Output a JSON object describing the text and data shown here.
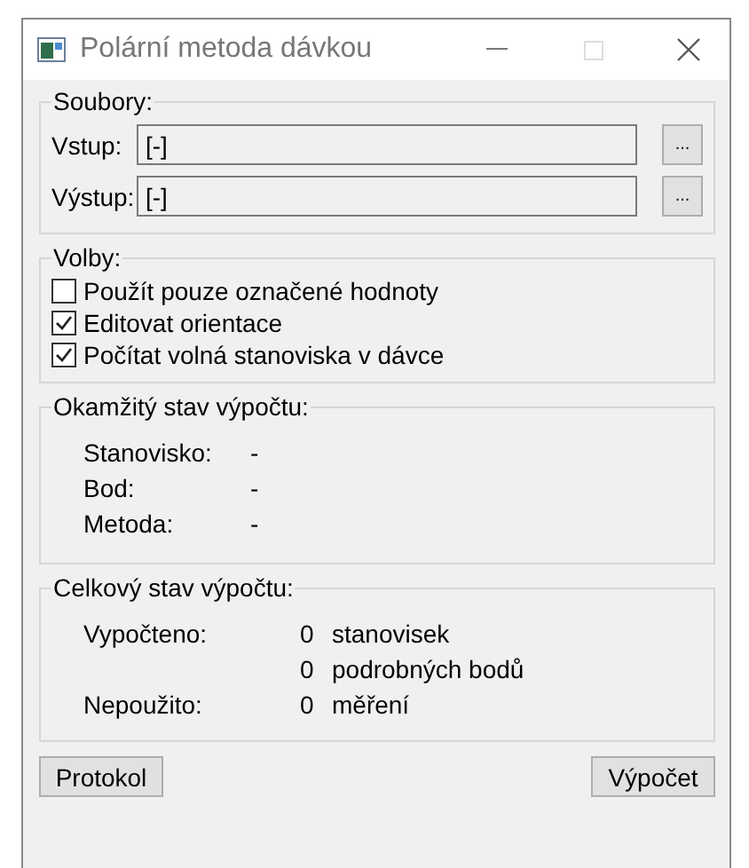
{
  "window": {
    "title": "Polární metoda dávkou"
  },
  "files": {
    "title": "Soubory:",
    "fields": [
      {
        "label": "Vstup:",
        "value": "[-]",
        "browse": "..."
      },
      {
        "label": "Výstup:",
        "value": "[-]",
        "browse": "..."
      }
    ]
  },
  "options": {
    "title": "Volby:",
    "items": [
      {
        "label": "Použít pouze označené hodnoty",
        "checked": false
      },
      {
        "label": "Editovat orientace",
        "checked": true
      },
      {
        "label": "Počítat volná stanoviska v dávce",
        "checked": true
      }
    ]
  },
  "current_state": {
    "title": "Okamžitý stav výpočtu:",
    "rows": [
      {
        "label": "Stanovisko:",
        "value": "-"
      },
      {
        "label": "Bod:",
        "value": "-"
      },
      {
        "label": "Metoda:",
        "value": "-"
      }
    ]
  },
  "overall_state": {
    "title": "Celkový stav výpočtu:",
    "rows": [
      {
        "label": "Vypočteno:",
        "count": "0",
        "unit": "stanovisek"
      },
      {
        "label": "",
        "count": "0",
        "unit": "podrobných bodů"
      },
      {
        "label": "Nepoužito:",
        "count": "0",
        "unit": "měření"
      }
    ]
  },
  "buttons": [
    "Protokol",
    "Výpočet"
  ]
}
